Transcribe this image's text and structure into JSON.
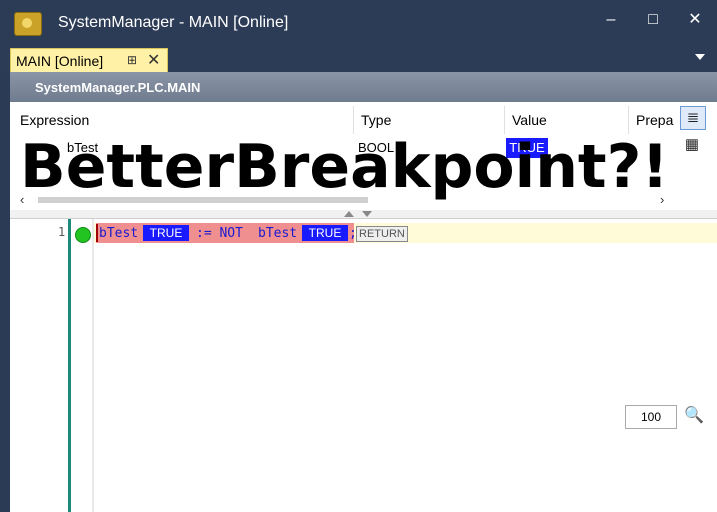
{
  "window": {
    "title": "SystemManager - MAIN [Online]",
    "app_icon": "twincat-icon",
    "minimize": "‒",
    "maximize": "□",
    "close": "✕"
  },
  "tab": {
    "label": "MAIN [Online]",
    "pin": "⊞",
    "close": "✕"
  },
  "panel": {
    "path": "SystemManager.PLC.MAIN"
  },
  "watch": {
    "columns": [
      "Expression",
      "Type",
      "Value",
      "Prepa"
    ],
    "rows": [
      {
        "expression": "bTest",
        "type": "BOOL",
        "value": "TRUE"
      }
    ]
  },
  "editor": {
    "line_number": "1",
    "code_var1": "bTest",
    "code_val1": "TRUE",
    "code_assign": ":= NOT",
    "code_var2": "bTest",
    "code_val2": "TRUE",
    "code_semicolon": ";",
    "return_label": "RETURN",
    "zoom": "100"
  },
  "overlay": {
    "text": "BetterBreakpoint?!"
  },
  "colors": {
    "title_bg": "#2d3c56",
    "tab_active": "#fff1a6",
    "breakpoint_line": "#f08f8f",
    "value_true": "#1a1aff",
    "breakpoint_dot": "#22c422"
  }
}
